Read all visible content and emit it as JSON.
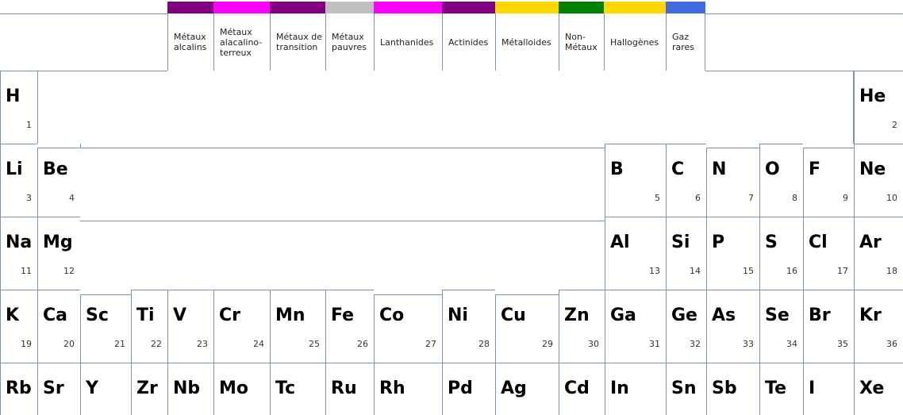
{
  "legend": [
    {
      "label": "Métaux alcalins",
      "color": "#800080"
    },
    {
      "label": "Métaux alacalino-terreux",
      "color": "#ff00ff"
    },
    {
      "label": "Métaux de transition",
      "color": "#800080"
    },
    {
      "label": "Métaux pauvres",
      "color": "#c0c0c0"
    },
    {
      "label": "Lanthanides",
      "color": "#ff00ff"
    },
    {
      "label": "Actinides",
      "color": "#800080"
    },
    {
      "label": "Métalloides",
      "color": "#ffd700"
    },
    {
      "label": "Non-Métaux",
      "color": "#008000"
    },
    {
      "label": "Hallogènes",
      "color": "#ffd700"
    },
    {
      "label": "Gaz rares",
      "color": "#4169e1"
    }
  ],
  "elements": [
    {
      "sym": "H",
      "num": "1"
    },
    {
      "sym": "He",
      "num": "2"
    },
    {
      "sym": "Li",
      "num": "3"
    },
    {
      "sym": "Be",
      "num": "4"
    },
    {
      "sym": "B",
      "num": "5"
    },
    {
      "sym": "C",
      "num": "6"
    },
    {
      "sym": "N",
      "num": "7"
    },
    {
      "sym": "O",
      "num": "8"
    },
    {
      "sym": "F",
      "num": "9"
    },
    {
      "sym": "Ne",
      "num": "10"
    },
    {
      "sym": "Na",
      "num": "11"
    },
    {
      "sym": "Mg",
      "num": "12"
    },
    {
      "sym": "Al",
      "num": "13"
    },
    {
      "sym": "Si",
      "num": "14"
    },
    {
      "sym": "P",
      "num": "15"
    },
    {
      "sym": "S",
      "num": "16"
    },
    {
      "sym": "Cl",
      "num": "17"
    },
    {
      "sym": "Ar",
      "num": "18"
    },
    {
      "sym": "K",
      "num": "19"
    },
    {
      "sym": "Ca",
      "num": "20"
    },
    {
      "sym": "Sc",
      "num": "21"
    },
    {
      "sym": "Ti",
      "num": "22"
    },
    {
      "sym": "V",
      "num": "23"
    },
    {
      "sym": "Cr",
      "num": "24"
    },
    {
      "sym": "Mn",
      "num": "25"
    },
    {
      "sym": "Fe",
      "num": "26"
    },
    {
      "sym": "Co",
      "num": "27"
    },
    {
      "sym": "Ni",
      "num": "28"
    },
    {
      "sym": "Cu",
      "num": "29"
    },
    {
      "sym": "Zn",
      "num": "30"
    },
    {
      "sym": "Ga",
      "num": "31"
    },
    {
      "sym": "Ge",
      "num": "32"
    },
    {
      "sym": "As",
      "num": "33"
    },
    {
      "sym": "Se",
      "num": "34"
    },
    {
      "sym": "Br",
      "num": "35"
    },
    {
      "sym": "Kr",
      "num": "36"
    },
    {
      "sym": "Rb",
      "num": ""
    },
    {
      "sym": "Sr",
      "num": ""
    },
    {
      "sym": "Y",
      "num": ""
    },
    {
      "sym": "Zr",
      "num": ""
    },
    {
      "sym": "Nb",
      "num": ""
    },
    {
      "sym": "Mo",
      "num": ""
    },
    {
      "sym": "Tc",
      "num": ""
    },
    {
      "sym": "Ru",
      "num": ""
    },
    {
      "sym": "Rh",
      "num": ""
    },
    {
      "sym": "Pd",
      "num": ""
    },
    {
      "sym": "Ag",
      "num": ""
    },
    {
      "sym": "Cd",
      "num": ""
    },
    {
      "sym": "In",
      "num": ""
    },
    {
      "sym": "Sn",
      "num": ""
    },
    {
      "sym": "Sb",
      "num": ""
    },
    {
      "sym": "Te",
      "num": ""
    },
    {
      "sym": "I",
      "num": ""
    },
    {
      "sym": "Xe",
      "num": ""
    }
  ]
}
